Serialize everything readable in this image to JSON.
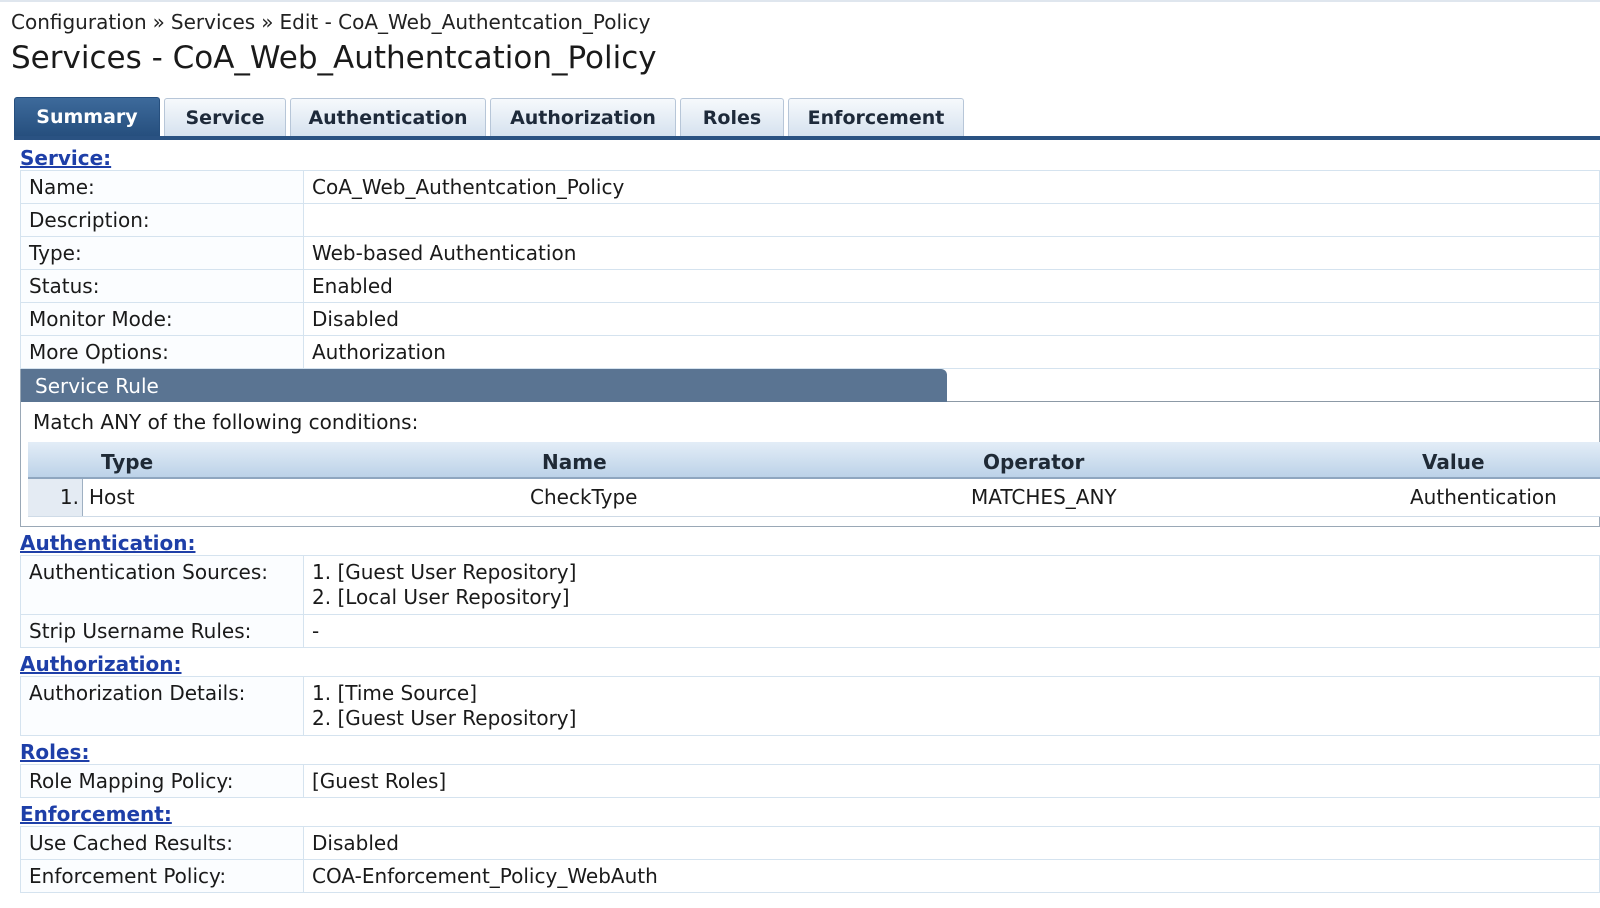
{
  "breadcrumb": {
    "items": [
      "Configuration",
      "Services",
      "Edit - CoA_Web_Authentcation_Policy"
    ],
    "separator": "»"
  },
  "page_title": "Services - CoA_Web_Authentcation_Policy",
  "tabs": [
    {
      "label": "Summary",
      "active": true
    },
    {
      "label": "Service",
      "active": false
    },
    {
      "label": "Authentication",
      "active": false
    },
    {
      "label": "Authorization",
      "active": false
    },
    {
      "label": "Roles",
      "active": false
    },
    {
      "label": "Enforcement",
      "active": false
    }
  ],
  "service": {
    "section_label": "Service:",
    "rows": [
      {
        "key": "Name:",
        "value": "CoA_Web_Authentcation_Policy"
      },
      {
        "key": "Description:",
        "value": ""
      },
      {
        "key": "Type:",
        "value": "Web-based Authentication"
      },
      {
        "key": "Status:",
        "value": "Enabled"
      },
      {
        "key": "Monitor Mode:",
        "value": "Disabled"
      },
      {
        "key": "More Options:",
        "value": "Authorization"
      }
    ]
  },
  "service_rule": {
    "title": "Service Rule",
    "match_text": "Match ANY of the following conditions:",
    "columns": [
      "Type",
      "Name",
      "Operator",
      "Value"
    ],
    "rows": [
      {
        "num": "1.",
        "type": "Host",
        "name": "CheckType",
        "operator": "MATCHES_ANY",
        "value": "Authentication"
      }
    ]
  },
  "authentication": {
    "section_label": "Authentication:",
    "sources_key": "Authentication Sources:",
    "sources": [
      "1. [Guest User Repository]",
      "2. [Local User Repository]"
    ],
    "strip_key": "Strip Username Rules:",
    "strip_value": "-"
  },
  "authorization": {
    "section_label": "Authorization:",
    "details_key": "Authorization Details:",
    "details": [
      "1. [Time Source]",
      "2. [Guest User Repository]"
    ]
  },
  "roles": {
    "section_label": "Roles:",
    "mapping_key": "Role Mapping Policy:",
    "mapping_value": "[Guest Roles]"
  },
  "enforcement": {
    "section_label": "Enforcement:",
    "rows": [
      {
        "key": "Use Cached Results:",
        "value": "Disabled"
      },
      {
        "key": "Enforcement Policy:",
        "value": "COA-Enforcement_Policy_WebAuth"
      }
    ]
  },
  "colors": {
    "tab_active": "#264f7e",
    "link": "#1e3fa8",
    "panel_header": "#5a7492"
  }
}
